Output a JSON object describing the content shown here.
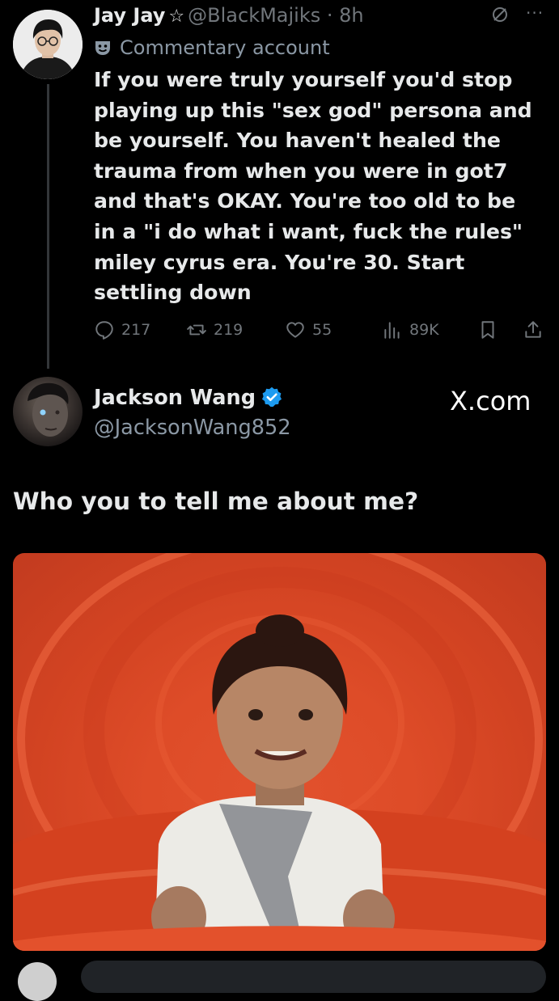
{
  "tweet1": {
    "display_name": "Jay Jay",
    "star": "☆",
    "handle_time": "@BlackMajiks · 8h",
    "label": "Commentary account",
    "text": "If you were truly yourself you'd stop\nplaying up this \"sex god\" persona and\nbe yourself. You haven't healed the\ntrauma from when you were in got7\nand that's OKAY. You're too old to be\nin a \"i do what i want, fuck the rules\"\nmiley cyrus era. You're 30. Start\nsettling down",
    "replies": "217",
    "reposts": "219",
    "likes": "55",
    "views": "89K",
    "more": "···"
  },
  "tweet2": {
    "display_name": "Jackson Wang",
    "handle": "@JacksonWang852",
    "source": "X.com",
    "text": "Who you to tell me about me?"
  },
  "colors": {
    "background": "#000000",
    "text": "#e7e9ea",
    "muted": "#71767b",
    "verified": "#1d9bf0",
    "media_orange": "#de4c28"
  }
}
